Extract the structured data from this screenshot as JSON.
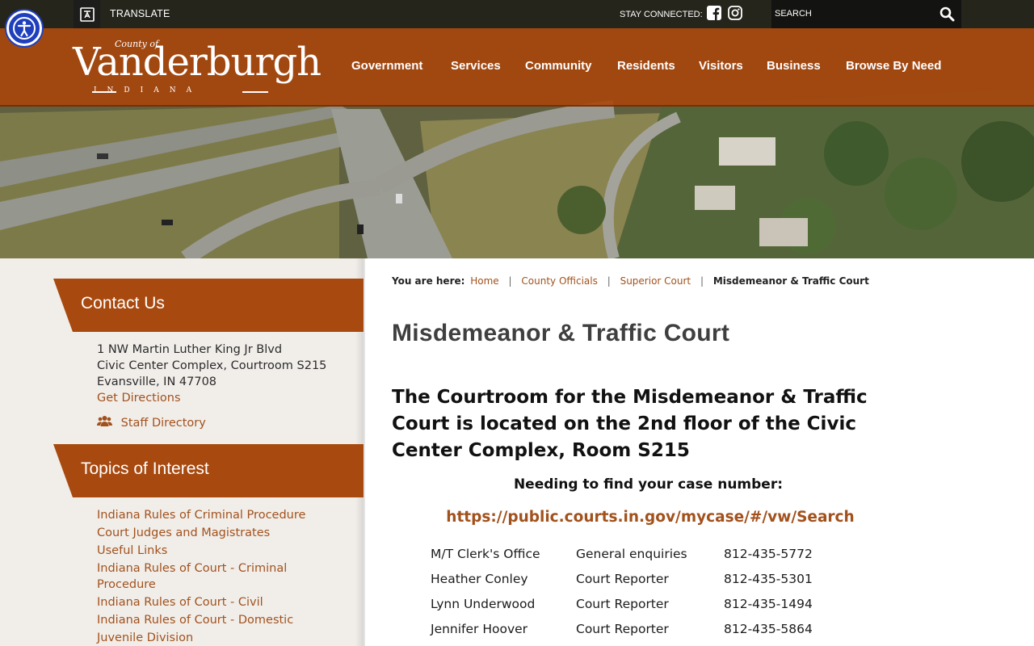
{
  "topbar": {
    "translate_label": "TRANSLATE",
    "stay_connected_label": "STAY CONNECTED:",
    "social_icons": [
      "facebook-icon",
      "instagram-icon"
    ],
    "search_label": "SEARCH"
  },
  "logo": {
    "small": "County of",
    "main": "Vanderburgh",
    "sub": "INDIANA"
  },
  "nav": {
    "items": [
      "Government",
      "Services",
      "Community",
      "Residents",
      "Visitors",
      "Business",
      "Browse By Need"
    ]
  },
  "sidebar": {
    "contact_heading": "Contact Us",
    "address": [
      "1 NW Martin Luther King Jr Blvd",
      "Civic Center Complex, Courtroom S215",
      "Evansville, IN 47708"
    ],
    "directions_link": "Get Directions",
    "staff_directory": "Staff Directory",
    "topics_heading": "Topics of Interest",
    "topics": [
      "Indiana Rules of Criminal Procedure",
      "Court Judges and Magistrates",
      "Useful Links",
      "Indiana Rules of Court - Criminal Procedure",
      "Indiana Rules of Court - Civil",
      "Indiana Rules of Court - Domestic",
      "Juvenile Division"
    ]
  },
  "breadcrumb": {
    "label": "You are here:",
    "links": [
      "Home",
      "County Officials",
      "Superior Court"
    ],
    "current": "Misdemeanor & Traffic Court"
  },
  "main": {
    "title": "Misdemeanor & Traffic Court",
    "lead": "The Courtroom for the Misdemeanor & Traffic Court is located on the 2nd floor of the Civic Center Complex, Room S215",
    "case_question": "Needing to find your case number:",
    "case_link": "https://public.courts.in.gov/mycase/#/vw/Search",
    "contacts": [
      {
        "name": "M/T Clerk's Office",
        "role": "General enquiries",
        "phone": "812-435-5772"
      },
      {
        "name": "Heather Conley",
        "role": "Court Reporter",
        "phone": "812-435-5301"
      },
      {
        "name": "Lynn Underwood",
        "role": "Court Reporter",
        "phone": "812-435-1494"
      },
      {
        "name": "Jennifer Hoover",
        "role": "Court Reporter",
        "phone": "812-435-5864"
      }
    ]
  },
  "colors": {
    "brand_orange": "#a84a10",
    "link": "#a2511c",
    "accessibility_blue": "#1f3fbd"
  }
}
